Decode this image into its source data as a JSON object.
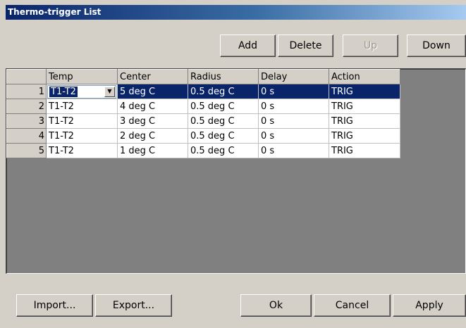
{
  "window": {
    "title": "Thermo-trigger List"
  },
  "toolbar": {
    "add": "Add",
    "delete": "Delete",
    "up": "Up",
    "down": "Down"
  },
  "table": {
    "headers": [
      "",
      "Temp",
      "Center",
      "Radius",
      "Delay",
      "Action"
    ],
    "rows": [
      {
        "num": "1",
        "temp": "T1-T2",
        "center": "5 deg C",
        "radius": "0.5 deg C",
        "delay": "0 s",
        "action": "TRIG"
      },
      {
        "num": "2",
        "temp": "T1-T2",
        "center": "4 deg C",
        "radius": "0.5 deg C",
        "delay": "0 s",
        "action": "TRIG"
      },
      {
        "num": "3",
        "temp": "T1-T2",
        "center": "3 deg C",
        "radius": "0.5 deg C",
        "delay": "0 s",
        "action": "TRIG"
      },
      {
        "num": "4",
        "temp": "T1-T2",
        "center": "2 deg C",
        "radius": "0.5 deg C",
        "delay": "0 s",
        "action": "TRIG"
      },
      {
        "num": "5",
        "temp": "T1-T2",
        "center": "1 deg C",
        "radius": "0.5 deg C",
        "delay": "0 s",
        "action": "TRIG"
      }
    ],
    "selected_row": 0,
    "combo_arrow_icon": "chevron-down-icon"
  },
  "footer": {
    "import": "Import...",
    "export": "Export...",
    "ok": "Ok",
    "cancel": "Cancel",
    "apply": "Apply"
  },
  "colors": {
    "title_start": "#0a246a",
    "title_end": "#a6caf0",
    "selection": "#0a246a",
    "face": "#d4d0c8",
    "grid_bg": "#808080"
  }
}
